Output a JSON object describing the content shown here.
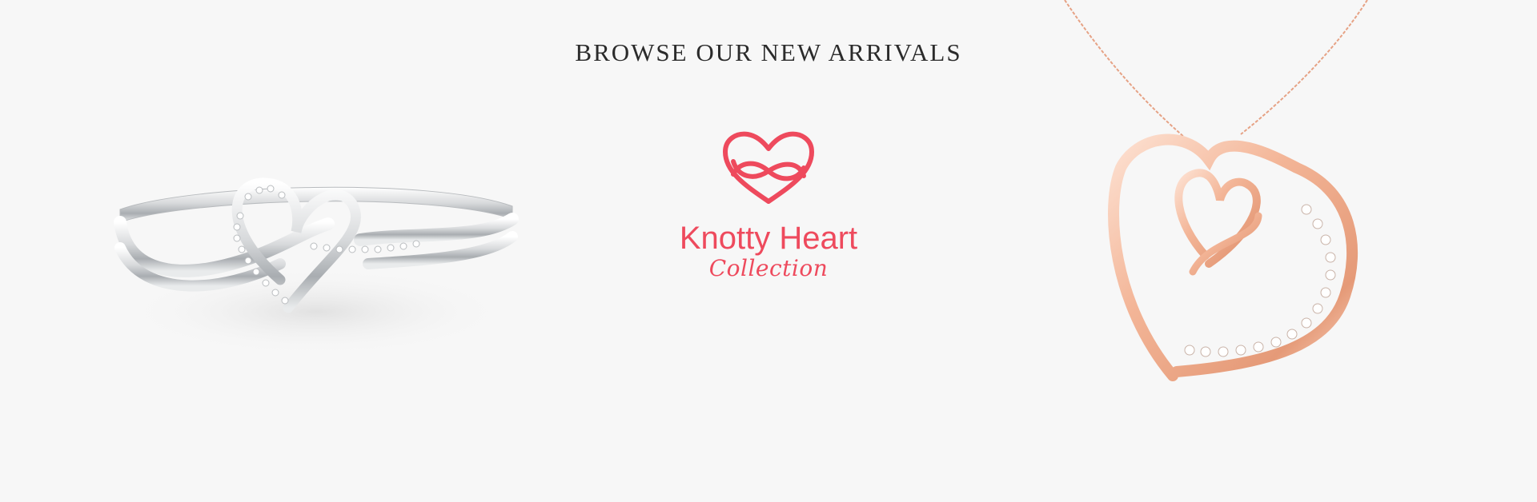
{
  "banner": {
    "headline": "BROWSE OUR NEW ARRIVALS",
    "logo": {
      "icon": "infinity-heart-icon",
      "title": "Knotty Heart",
      "subtitle": "Collection",
      "color": "#ee4a5d"
    },
    "left_product": {
      "icon": "heart-ring-image",
      "metal_color": "#d9dbdd"
    },
    "right_product": {
      "icon": "heart-pendant-image",
      "metal_color": "#f1b394"
    },
    "background_color": "#f7f7f7"
  }
}
